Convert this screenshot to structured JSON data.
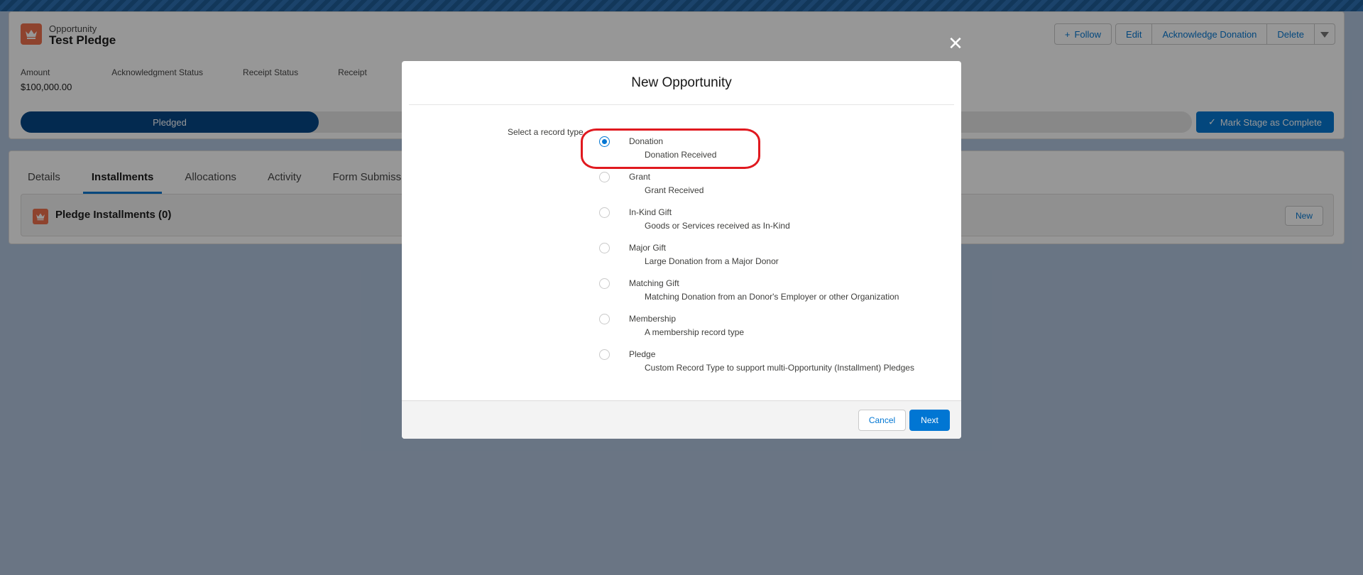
{
  "record": {
    "type": "Opportunity",
    "title": "Test Pledge",
    "icon": "crown-icon",
    "actions": {
      "follow": "Follow",
      "edit": "Edit",
      "acknowledge": "Acknowledge Donation",
      "delete": "Delete"
    },
    "fields": [
      {
        "label": "Amount",
        "value": "$100,000.00"
      },
      {
        "label": "Acknowledgment Status",
        "value": ""
      },
      {
        "label": "Receipt Status",
        "value": ""
      },
      {
        "label": "Receipt",
        "value": ""
      }
    ],
    "path_stage": "Pledged",
    "mark_complete": "Mark Stage as Complete"
  },
  "tabs": [
    {
      "label": "Details",
      "active": false
    },
    {
      "label": "Installments",
      "active": true
    },
    {
      "label": "Allocations",
      "active": false
    },
    {
      "label": "Activity",
      "active": false
    },
    {
      "label": "Form Submissi",
      "active": false
    }
  ],
  "related": {
    "title": "Pledge Installments (0)",
    "new_label": "New"
  },
  "modal": {
    "title": "New Opportunity",
    "select_label": "Select a record type",
    "options": [
      {
        "name": "Donation",
        "desc": "Donation Received",
        "checked": true
      },
      {
        "name": "Grant",
        "desc": "Grant Received",
        "checked": false
      },
      {
        "name": "In-Kind Gift",
        "desc": "Goods or Services received as In-Kind",
        "checked": false
      },
      {
        "name": "Major Gift",
        "desc": "Large Donation from a Major Donor",
        "checked": false
      },
      {
        "name": "Matching Gift",
        "desc": "Matching Donation from an Donor's Employer or other Organization",
        "checked": false
      },
      {
        "name": "Membership",
        "desc": "A membership record type",
        "checked": false
      },
      {
        "name": "Pledge",
        "desc": "Custom Record Type to support multi-Opportunity (Installment) Pledges",
        "checked": false
      }
    ],
    "cancel": "Cancel",
    "next": "Next",
    "close_icon": "close-icon"
  },
  "colors": {
    "brand": "#0176d3",
    "path_active": "#014486",
    "highlight": "#e0191f"
  }
}
